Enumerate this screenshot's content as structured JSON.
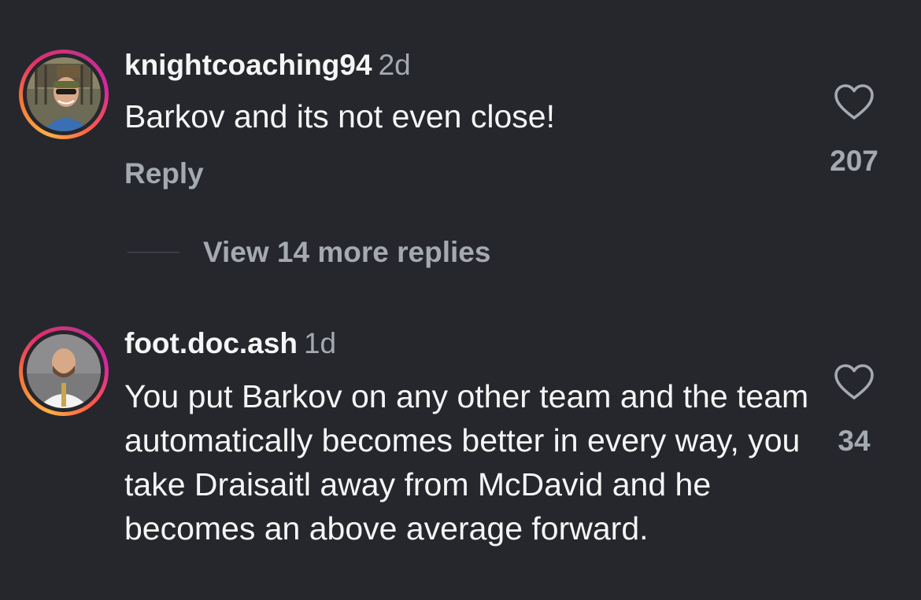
{
  "comments": [
    {
      "username": "knightcoaching94",
      "timestamp": "2d",
      "text": "Barkov and its not even close!",
      "reply_label": "Reply",
      "like_count": "207",
      "view_replies_label": "View 14 more replies",
      "like_icon": "heart-outline-icon"
    },
    {
      "username": "foot.doc.ash",
      "timestamp": "1d",
      "text": "You put Barkov on any other team and the team automatically becomes better in every way, you take Draisaitl away from McDavid and he becomes an above average forward.",
      "like_count": "34",
      "like_icon": "heart-outline-icon"
    }
  ],
  "colors": {
    "background": "#25272c",
    "primary_text": "#f5f5f5",
    "secondary_text": "#a5a9b0"
  }
}
